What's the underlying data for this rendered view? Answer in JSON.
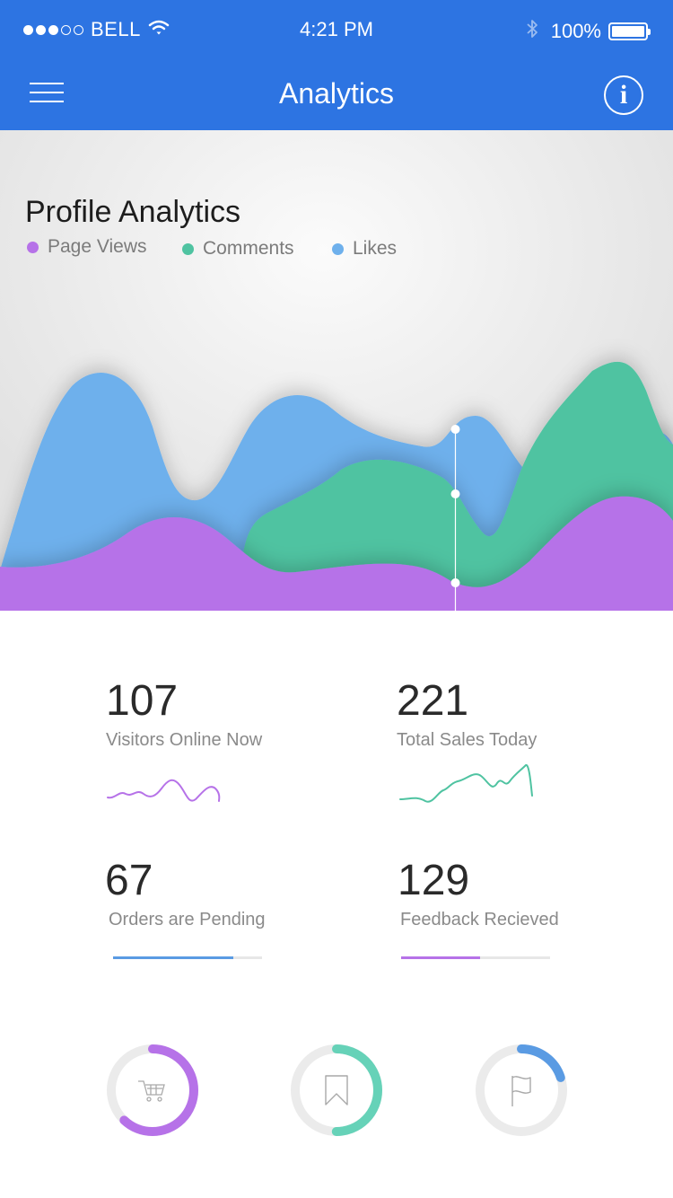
{
  "status_bar": {
    "carrier": "BELL",
    "time": "4:21 PM",
    "battery": "100%"
  },
  "header": {
    "title": "Analytics",
    "menu_icon": "hamburger-menu-icon",
    "info_icon": "info-icon"
  },
  "colors": {
    "header": "#2d74e2",
    "page_views": "#b672e8",
    "comments": "#4fc3a1",
    "likes": "#6eb0ec"
  },
  "chart_data": {
    "type": "area",
    "title": "Profile Analytics",
    "series": [
      {
        "name": "Page Views",
        "color": "#b672e8"
      },
      {
        "name": "Comments",
        "color": "#4fc3a1"
      },
      {
        "name": "Likes",
        "color": "#6eb0ec"
      }
    ],
    "grid": false
  },
  "stats": [
    {
      "value": "107",
      "label": "Visitors Online Now"
    },
    {
      "value": "221",
      "label": "Total Sales Today"
    },
    {
      "value": "67",
      "label": "Orders are Pending",
      "progress": 0.81,
      "color": "#5a9be3"
    },
    {
      "value": "129",
      "label": "Feedback Recieved",
      "progress": 0.53,
      "color": "#b672e8"
    }
  ],
  "rings": [
    {
      "icon": "cart-icon",
      "progress": 0.62,
      "color": "#b672e8"
    },
    {
      "icon": "bookmark-icon",
      "progress": 0.5,
      "color": "#66d2b8"
    },
    {
      "icon": "flag-icon",
      "progress": 0.2,
      "color": "#5a9be3"
    }
  ]
}
